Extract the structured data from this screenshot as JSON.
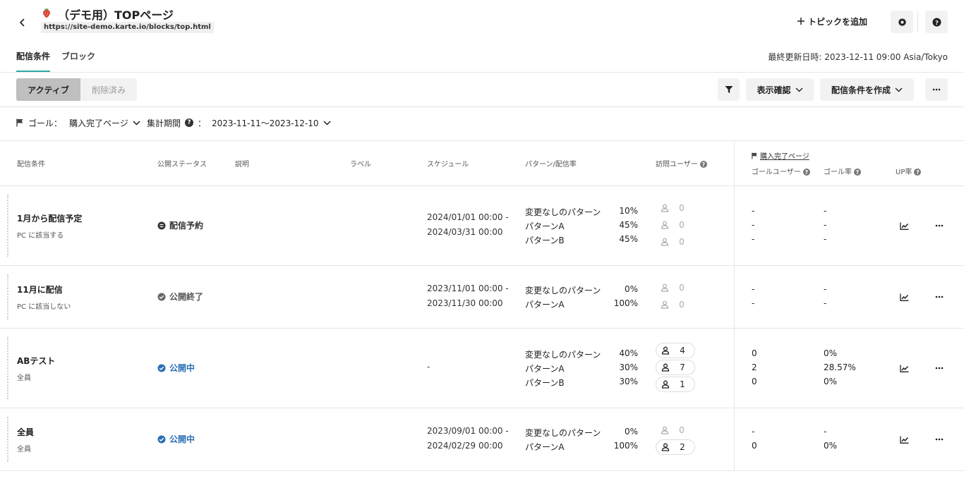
{
  "header": {
    "title": "（デモ用）TOPページ",
    "url": "https://site-demo.karte.io/blocks/top.html",
    "add_topic_label": "トピックを追加"
  },
  "tabs": [
    {
      "label": "配信条件",
      "active": true
    },
    {
      "label": "ブロック",
      "active": false
    }
  ],
  "last_updated": "最終更新日時: 2023-12-11 09:00 Asia/Tokyo",
  "toolbar": {
    "segments": [
      "アクティブ",
      "削除済み"
    ],
    "display_check_label": "表示確認",
    "create_condition_label": "配信条件を作成"
  },
  "filters": {
    "goal_label": "ゴール：",
    "goal_value": "購入完了ページ",
    "period_label": "集計期間",
    "period_sep": "：",
    "period_value": "2023-11-11〜2023-12-10"
  },
  "table": {
    "columns": {
      "condition": "配信条件",
      "status": "公開ステータス",
      "description": "説明",
      "label": "ラベル",
      "schedule": "スケジュール",
      "pattern": "パターン/配信率",
      "visitors": "訪問ユーザー",
      "goal_group": "購入完了ページ",
      "goal_users": "ゴールユーザー",
      "goal_rate": "ゴール率",
      "up_rate": "UP率"
    },
    "rows": [
      {
        "name": "1月から配信予定",
        "sub": "PC に該当する",
        "status": "配信予約",
        "schedule": [
          "2024/01/01 00:00 -",
          "2024/03/31 00:00"
        ],
        "patterns": [
          {
            "name": "変更なしのパターン",
            "rate": "10%",
            "visitors": "0",
            "goal_users": "-",
            "goal_rate": "-"
          },
          {
            "name": "パターンA",
            "rate": "45%",
            "visitors": "0",
            "goal_users": "-",
            "goal_rate": "-"
          },
          {
            "name": "パターンB",
            "rate": "45%",
            "visitors": "0",
            "goal_users": "-",
            "goal_rate": "-"
          }
        ]
      },
      {
        "name": "11月に配信",
        "sub": "PC に該当しない",
        "status": "公開終了",
        "schedule": [
          "2023/11/01 00:00 -",
          "2023/11/30 00:00"
        ],
        "patterns": [
          {
            "name": "変更なしのパターン",
            "rate": "0%",
            "visitors": "0",
            "goal_users": "-",
            "goal_rate": "-"
          },
          {
            "name": "パターンA",
            "rate": "100%",
            "visitors": "0",
            "goal_users": "-",
            "goal_rate": "-"
          }
        ]
      },
      {
        "name": "ABテスト",
        "sub": "全員",
        "status": "公開中",
        "schedule": [
          "-"
        ],
        "patterns": [
          {
            "name": "変更なしのパターン",
            "rate": "40%",
            "visitors": "4",
            "goal_users": "0",
            "goal_rate": "0%"
          },
          {
            "name": "パターンA",
            "rate": "30%",
            "visitors": "7",
            "goal_users": "2",
            "goal_rate": "28.57%"
          },
          {
            "name": "パターンB",
            "rate": "30%",
            "visitors": "1",
            "goal_users": "0",
            "goal_rate": "0%"
          }
        ]
      },
      {
        "name": "全員",
        "sub": "全員",
        "status": "公開中",
        "schedule": [
          "2023/09/01 00:00 -",
          "2024/02/29 00:00"
        ],
        "patterns": [
          {
            "name": "変更なしのパターン",
            "rate": "0%",
            "visitors": "0",
            "goal_users": "-",
            "goal_rate": "-"
          },
          {
            "name": "パターンA",
            "rate": "100%",
            "visitors": "2",
            "goal_users": "0",
            "goal_rate": "0%"
          }
        ]
      }
    ]
  },
  "colors": {
    "accent": "#2fa8a0",
    "status_live": "#2a6fb5",
    "status_other": "#333333",
    "status_ended": "#555555"
  }
}
